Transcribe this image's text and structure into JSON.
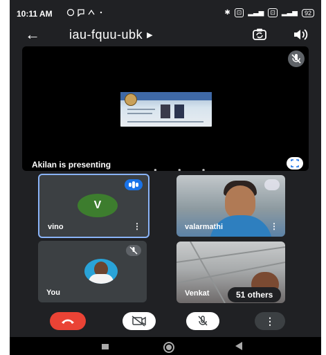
{
  "status_bar": {
    "time": "10:11 AM",
    "battery": "92"
  },
  "meeting": {
    "code": "iau-fquu-ubk"
  },
  "presentation": {
    "label": "Akilan is presenting"
  },
  "participants": [
    {
      "name": "vino",
      "avatar_letter": "V",
      "avatar_color": "#3d7d2e",
      "speaking": true
    },
    {
      "name": "valarmathi"
    },
    {
      "name": "You"
    },
    {
      "name": "Venkat"
    }
  ],
  "others_badge": "51 others",
  "colors": {
    "end_call": "#ea4335",
    "accent": "#1a73e8",
    "active_border": "#8ab4f8",
    "background": "#202124"
  },
  "icons": {
    "back": "arrow-left-icon",
    "switch_camera": "camera-switch-icon",
    "speaker": "speaker-icon",
    "mic_off": "mic-off-icon",
    "camera_off": "camera-off-icon",
    "end_call": "phone-hangup-icon",
    "more": "more-vert-icon",
    "fullscreen": "fullscreen-icon"
  }
}
